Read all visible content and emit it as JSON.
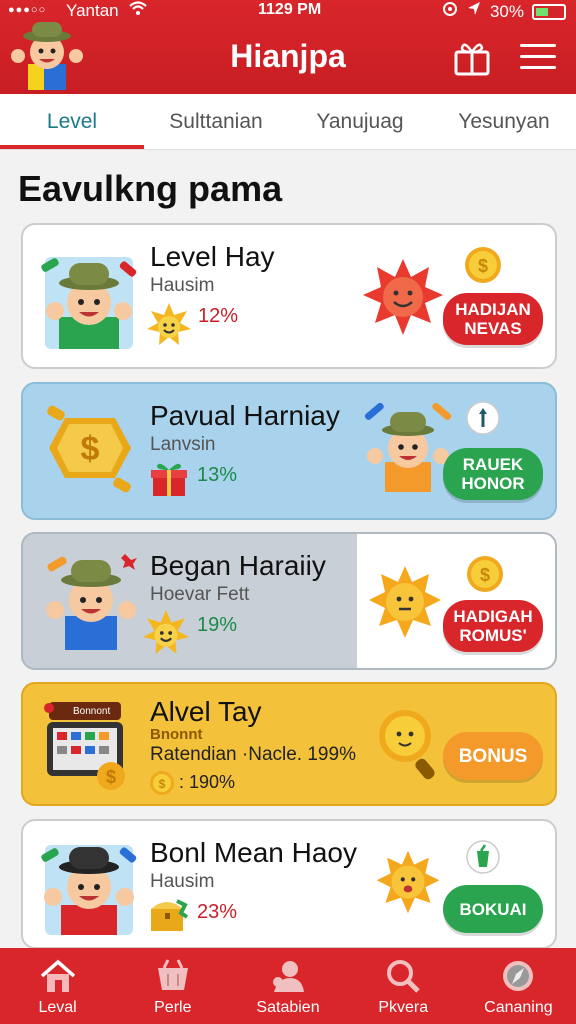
{
  "status_bar": {
    "dots": "●●●○○",
    "carrier": "Yantan",
    "time": "1129 PM",
    "battery": "30%"
  },
  "header": {
    "title": "Hianjpa"
  },
  "tabs": [
    {
      "label": "Level",
      "active": true
    },
    {
      "label": "Sulttanian"
    },
    {
      "label": "Yanujuag"
    },
    {
      "label": "Yesunyan"
    }
  ],
  "section_title": "Eavulkng pama",
  "cards": [
    {
      "title": "Level Hay",
      "subtitle": "Hausim",
      "percent": "12%",
      "button": "HADIJAN NEVAS",
      "bg": "#ffffff"
    },
    {
      "title": "Pavual Harniay",
      "subtitle": "Lanvsin",
      "percent": "13%",
      "button": "RAUEK HONOR",
      "bg": "#a9d3ec"
    },
    {
      "title": "Began Haraiiy",
      "subtitle": "Hoevar Fett",
      "percent": "19%",
      "button": "HADIGAH ROMUS'",
      "bg": "#c8cfd6"
    },
    {
      "title": "Alvel Tay",
      "badge": "Bonnont",
      "subtitle_small": "Bnonnt",
      "subtitle": "Ratendian ·Nacle. 199%",
      "percent": ": 190%",
      "button": "BONUS",
      "bg": "#f3c13a"
    },
    {
      "title": "Bonl Mean Haoy",
      "subtitle": "Hausim",
      "percent": "23%",
      "button": "BOKUAI",
      "bg": "#ffffff"
    }
  ],
  "bottom_nav": [
    {
      "label": "Leval",
      "icon": "home-icon"
    },
    {
      "label": "Perle",
      "icon": "basket-icon"
    },
    {
      "label": "Satabien",
      "icon": "user-icon"
    },
    {
      "label": "Pkvera",
      "icon": "search-icon"
    },
    {
      "label": "Cananing",
      "icon": "compass-icon"
    }
  ],
  "colors": {
    "brand": "#d8262b",
    "tab_active": "#1a7a8c"
  }
}
